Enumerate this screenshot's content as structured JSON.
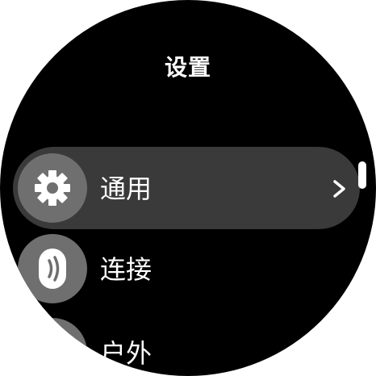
{
  "screen": {
    "title": "设置"
  },
  "menu": {
    "items": [
      {
        "label": "通用",
        "icon": "gear-icon",
        "selected": true
      },
      {
        "label": "连接",
        "icon": "connection-icon"
      },
      {
        "label": "户外",
        "icon": "outdoor-icon"
      }
    ]
  },
  "colors": {
    "background": "#000000",
    "selected_row": "#3a3a3a",
    "icon_circle": "#6f6f6f",
    "text": "#ffffff"
  }
}
